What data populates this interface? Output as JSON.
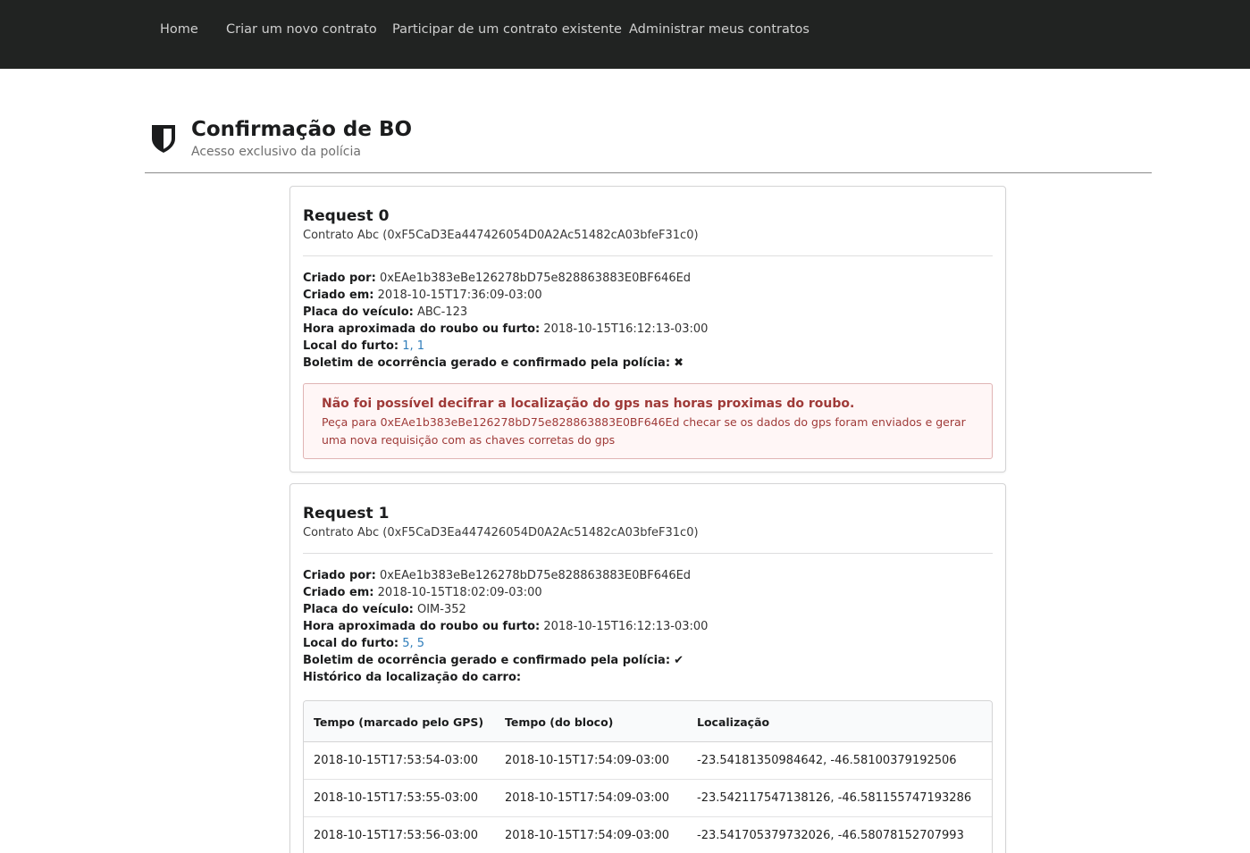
{
  "nav": {
    "items": [
      {
        "label": "Home"
      },
      {
        "label": "Criar um novo contrato"
      },
      {
        "label": "Participar de um contrato existente"
      },
      {
        "label": "Administrar meus contratos"
      }
    ]
  },
  "header": {
    "icon": "shield-icon",
    "title": "Confirmação de BO",
    "subtitle": "Acesso exclusivo da polícia"
  },
  "labels": {
    "created_by": "Criado por:",
    "created_at": "Criado em:",
    "plate": "Placa do veículo:",
    "approx_time": "Hora aproximada do roubo ou furto:",
    "location": "Local do furto:",
    "bo_confirmed": "Boletim de ocorrência gerado e confirmado pela polícia:",
    "history": "Histórico da localização do carro:"
  },
  "requests": [
    {
      "title": "Request 0",
      "contract": "Contrato Abc (0xF5CaD3Ea447426054D0A2Ac51482cA03bfeF31c0)",
      "created_by": "0xEAe1b383eBe126278bD75e828863883E0BF646Ed",
      "created_at": "2018-10-15T17:36:09-03:00",
      "plate": "ABC-123",
      "approx_time": "2018-10-15T16:12:13-03:00",
      "location": "1, 1",
      "bo_confirmed_mark": "✖",
      "bo_confirmed_icon": "x-icon",
      "alert": {
        "title": "Não foi possível decifrar a localização do gps nas horas proximas do roubo.",
        "text": "Peça para 0xEAe1b383eBe126278bD75e828863883E0BF646Ed checar se os dados do gps foram enviados e gerar uma nova requisição com as chaves corretas do gps"
      }
    },
    {
      "title": "Request 1",
      "contract": "Contrato Abc (0xF5CaD3Ea447426054D0A2Ac51482cA03bfeF31c0)",
      "created_by": "0xEAe1b383eBe126278bD75e828863883E0BF646Ed",
      "created_at": "2018-10-15T18:02:09-03:00",
      "plate": "OIM-352",
      "approx_time": "2018-10-15T16:12:13-03:00",
      "location": "5, 5",
      "bo_confirmed_mark": "✔",
      "bo_confirmed_icon": "check-icon",
      "table": {
        "columns": [
          "Tempo (marcado pelo GPS)",
          "Tempo (do bloco)",
          "Localização"
        ],
        "rows": [
          [
            "2018-10-15T17:53:54-03:00",
            "2018-10-15T17:54:09-03:00",
            "-23.54181350984642, -46.58100379192506"
          ],
          [
            "2018-10-15T17:53:55-03:00",
            "2018-10-15T17:54:09-03:00",
            "-23.542117547138126, -46.581155747193286"
          ],
          [
            "2018-10-15T17:53:56-03:00",
            "2018-10-15T17:54:09-03:00",
            "-23.541705379732026, -46.58078152707993"
          ]
        ]
      }
    }
  ],
  "colors": {
    "navbar_bg": "#212322",
    "link": "#2f7dba",
    "error_text": "#9f3a38",
    "error_bg": "#fff6f6",
    "error_border": "#e0b4b4"
  }
}
